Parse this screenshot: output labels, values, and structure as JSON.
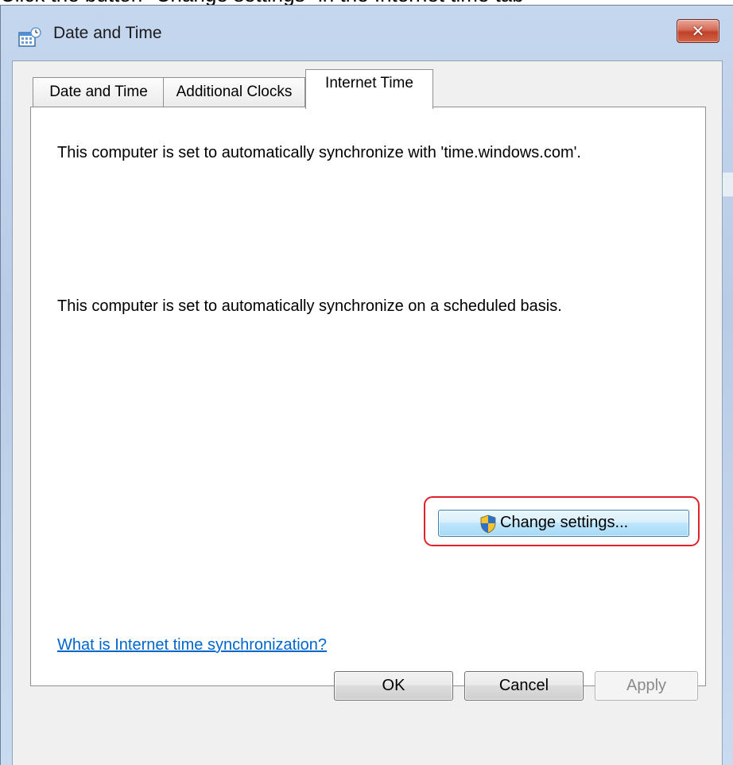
{
  "caption": "Click the button \"Change settings\" in the Internet time tab",
  "window": {
    "title": "Date and Time",
    "close_glyph": "✕"
  },
  "tabs": [
    {
      "label": "Date and Time",
      "active": false
    },
    {
      "label": "Additional Clocks",
      "active": false
    },
    {
      "label": "Internet Time",
      "active": true
    }
  ],
  "panel": {
    "sync_server_text": "This computer is set to automatically synchronize with 'time.windows.com'.",
    "schedule_text": "This computer is set to automatically synchronize on a scheduled basis.",
    "change_settings_label": "Change settings...",
    "help_link": "What is Internet time synchronization?"
  },
  "footer": {
    "ok_label": "OK",
    "cancel_label": "Cancel",
    "apply_label": "Apply"
  },
  "colors": {
    "highlight": "#e0232b",
    "link": "#0066cc"
  },
  "icons": {
    "title": "calendar-clock-icon",
    "change_settings": "uac-shield-icon",
    "close": "close-icon"
  }
}
